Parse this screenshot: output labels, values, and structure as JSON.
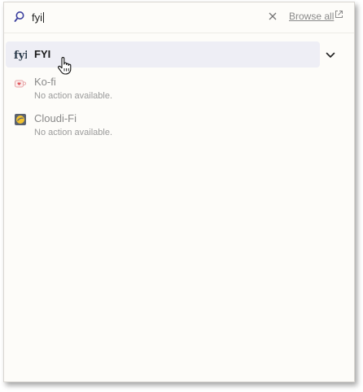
{
  "search": {
    "value": "fyi",
    "browse_all_label": "Browse all"
  },
  "icons": {
    "search": "search-icon",
    "clear": "close-icon",
    "external": "external-link-icon",
    "expand": "chevron-down-icon",
    "cursor": "hand-pointer-icon"
  },
  "results": [
    {
      "title": "FYI",
      "subtitle": "",
      "icon": "fyi-logo-icon",
      "selected": true
    },
    {
      "title": "Ko-fi",
      "subtitle": "No action available.",
      "icon": "kofi-cup-icon",
      "selected": false
    },
    {
      "title": "Cloudi-Fi",
      "subtitle": "No action available.",
      "icon": "cloudifi-logo-icon",
      "selected": false
    }
  ],
  "colors": {
    "accent": "#3b3f9e",
    "selected_row_bg": "#eeeef5",
    "panel_bg": "#fdfcf9",
    "muted_text": "#9a9a9a",
    "kofi_red": "#e0575b",
    "cloudifi_yellow": "#f2c230"
  }
}
